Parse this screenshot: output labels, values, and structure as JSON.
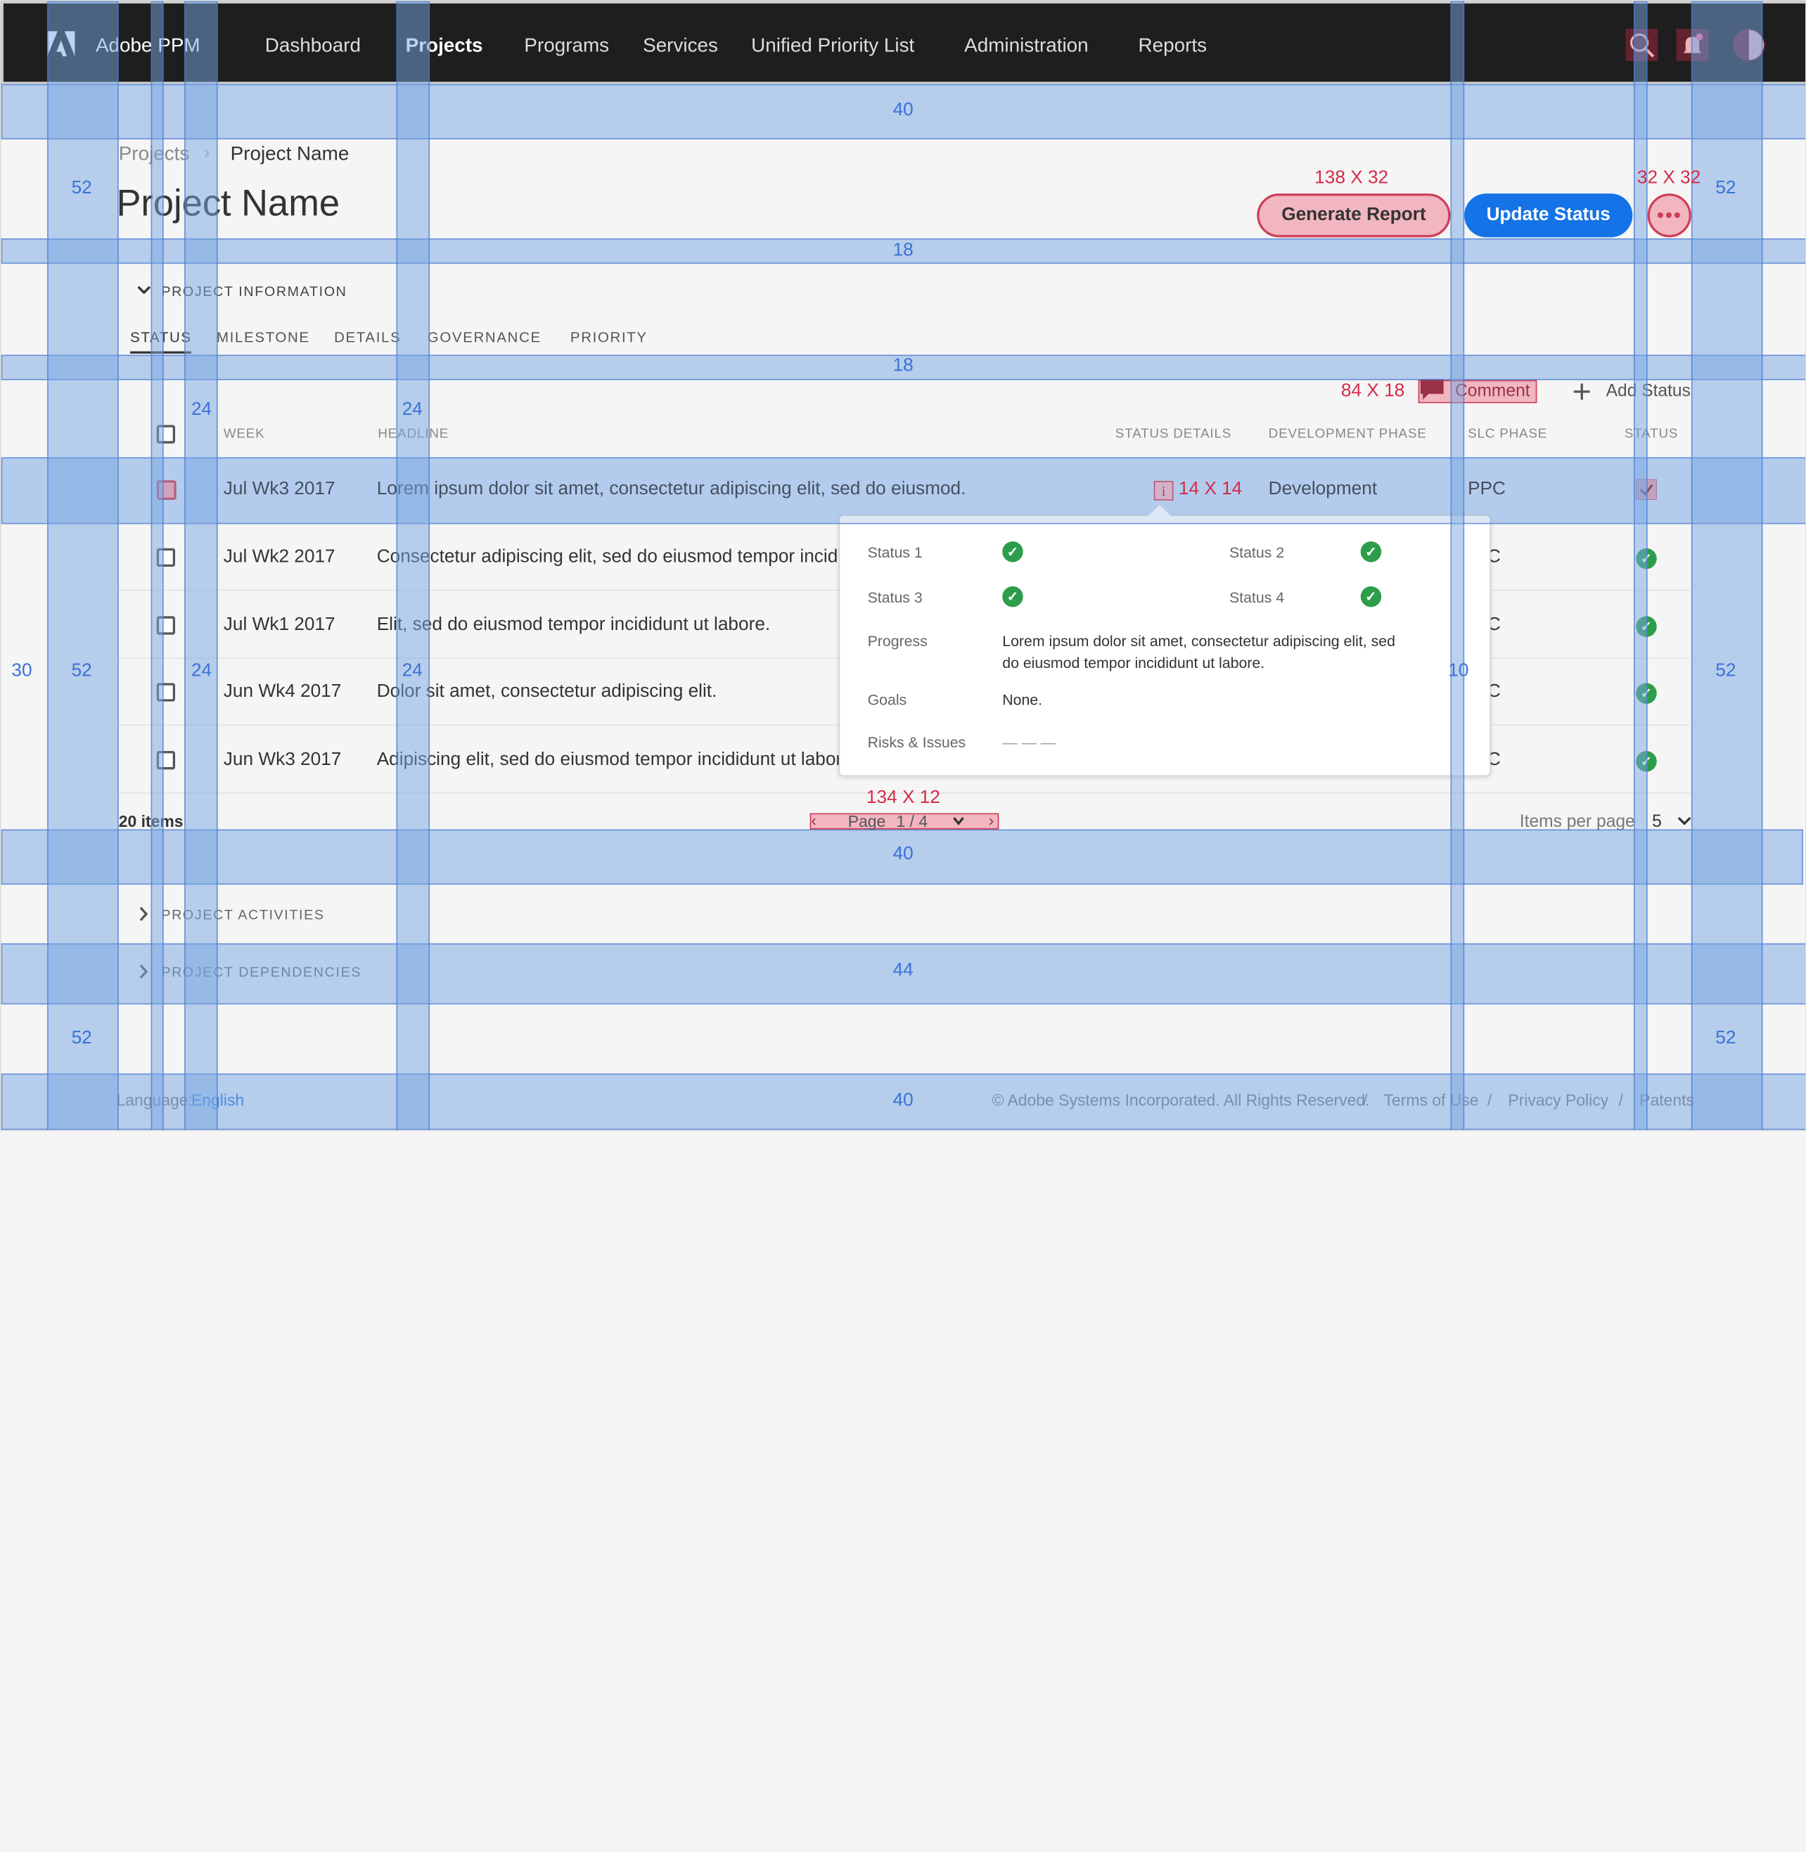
{
  "nav": {
    "brand": "Adobe PPM",
    "items": [
      "Dashboard",
      "Projects",
      "Programs",
      "Services",
      "Unified Priority List",
      "Administration",
      "Reports"
    ],
    "active": "Projects"
  },
  "breadcrumb": {
    "parent": "Projects",
    "current": "Project Name",
    "separator": "›"
  },
  "title": "Project Name",
  "buttons": {
    "generate": "Generate Report",
    "update": "Update Status",
    "more": "•••"
  },
  "sections": {
    "info": "PROJECT INFORMATION",
    "activities": "PROJECT ACTIVITIES",
    "dependencies": "PROJECT DEPENDENCIES"
  },
  "tabs": [
    "STATUS",
    "MILESTONE",
    "DETAILS",
    "GOVERNANCE",
    "PRIORITY"
  ],
  "actions": {
    "comment": "Comment",
    "add": "Add Status"
  },
  "table": {
    "headers": [
      "WEEK",
      "HEADLINE",
      "STATUS DETAILS",
      "DEVELOPMENT PHASE",
      "SLC PHASE",
      "STATUS"
    ],
    "rows": [
      {
        "week": "Jul Wk3 2017",
        "headline": "Lorem ipsum dolor sit amet, consectetur adipiscing elit, sed do eiusmod.",
        "phase": "Development",
        "slc": "PPC"
      },
      {
        "week": "Jul Wk2 2017",
        "headline": "Consectetur adipiscing elit, sed do eiusmod tempor incidic",
        "slc": "C"
      },
      {
        "week": "Jul Wk1 2017",
        "headline": "Elit, sed do eiusmod tempor incididunt ut labore.",
        "slc": "C"
      },
      {
        "week": "Jun Wk4 2017",
        "headline": "Dolor sit amet, consectetur adipiscing elit.",
        "slc": "C"
      },
      {
        "week": "Jun Wk3 2017",
        "headline": "Adipiscing elit, sed do eiusmod tempor incididunt ut labor",
        "slc": "C"
      }
    ]
  },
  "popover": {
    "status1": "Status 1",
    "status2": "Status 2",
    "status3": "Status 3",
    "status4": "Status 4",
    "progress_label": "Progress",
    "progress_line1": "Lorem ipsum dolor sit amet, consectetur adipiscing elit, sed",
    "progress_line2": "do eiusmod tempor incididunt ut labore.",
    "goals_label": "Goals",
    "goals": "None.",
    "risks_label": "Risks & Issues",
    "risks": "— — —"
  },
  "pagination": {
    "count": "20 items",
    "page": "Page",
    "page_value": "1 / 4",
    "ipp_label": "Items per page",
    "ipp_value": "5"
  },
  "footer": {
    "language_label": "Language:",
    "language": "English",
    "copyright": "© Adobe Systems Incorporated. All Rights Reserved.",
    "sep": "/",
    "terms": "Terms of Use",
    "privacy": "Privacy Policy",
    "patents": "Patents"
  },
  "spec_labels": {
    "s40a": "40",
    "s52a": "52",
    "s52b": "52",
    "s18a": "18",
    "s18b": "18",
    "s24a": "24",
    "s24b": "24",
    "s24c": "24",
    "s24d": "24",
    "s30": "30",
    "s52c": "52",
    "s52d": "52",
    "s10": "10",
    "s40b": "40",
    "s44": "44",
    "s52e": "52",
    "s52f": "52",
    "s40c": "40",
    "d_gen": "138 X 32",
    "d_more": "32 X 32",
    "d_comment": "84 X 18",
    "d_info": "14 X 14",
    "d_pager": "134 X 12"
  },
  "colors": {
    "nav_bg": "#1e1e1e",
    "primary": "#1473e6",
    "spec_red": "#d42c4a",
    "spec_blue": "#3a72d8",
    "success": "#2d9d4b"
  }
}
